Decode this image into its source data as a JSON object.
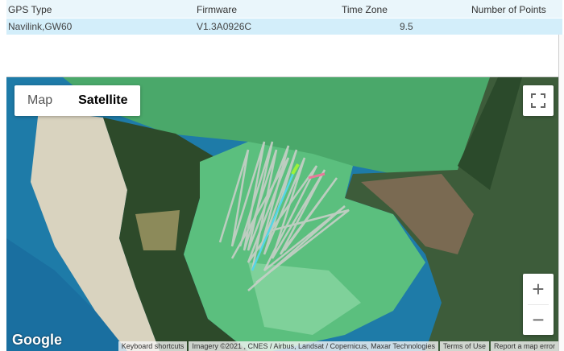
{
  "table": {
    "headers": [
      "GPS Type",
      "Firmware",
      "Time Zone",
      "Number of Points"
    ],
    "row": [
      "Navilink,GW60",
      "V1.3A0926C",
      "9.5",
      ""
    ]
  },
  "map": {
    "type_control": {
      "map_label": "Map",
      "satellite_label": "Satellite",
      "selected": "Satellite"
    },
    "fullscreen_icon": "fullscreen-icon",
    "zoom_in_label": "+",
    "zoom_out_label": "−",
    "logo": "Google",
    "attribution": {
      "shortcuts": "Keyboard shortcuts",
      "imagery": "Imagery ©2021 , CNES / Airbus, Landsat / Copernicus, Maxar Technologies",
      "terms": "Terms of Use",
      "report": "Report a map error"
    },
    "colors": {
      "track": "#c8cfc8",
      "track_highlight": "#55d6e6",
      "water": "#1e7ba8",
      "lagoon": "#5bbf7e"
    }
  }
}
